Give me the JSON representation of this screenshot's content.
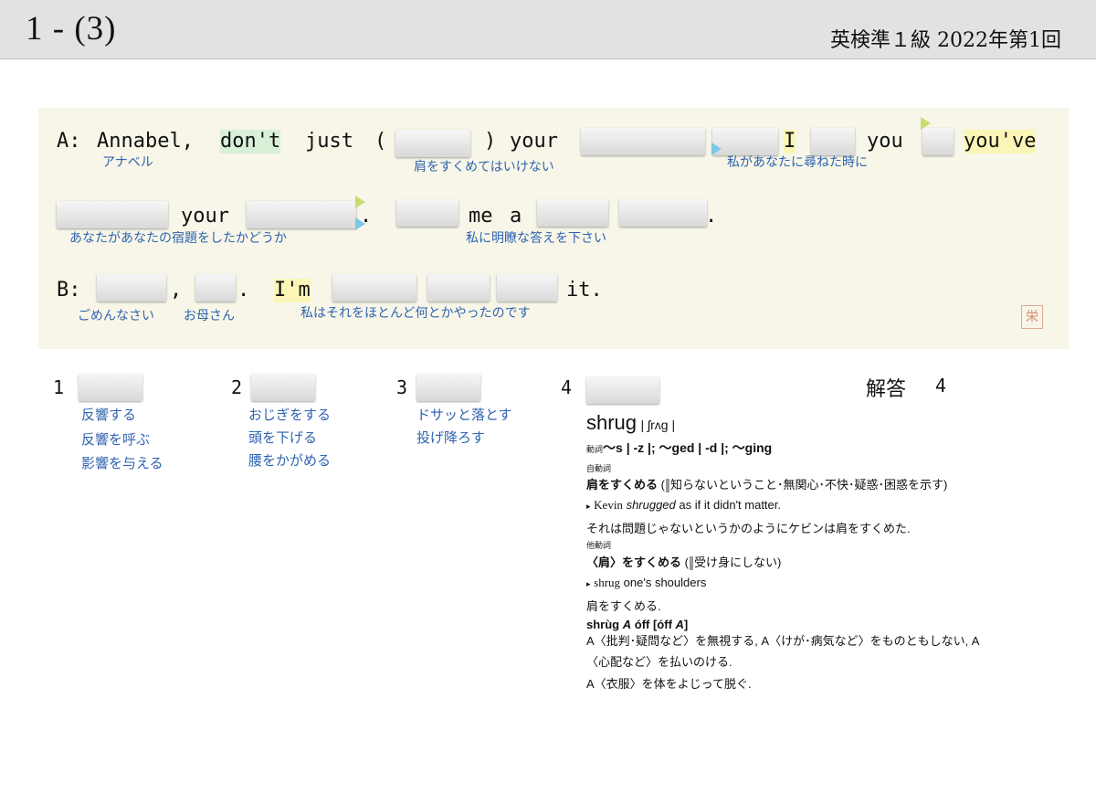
{
  "header": {
    "title": "1 - (3)",
    "subtitle": "英検準１級  2022年第1回"
  },
  "passage": {
    "line1": {
      "speaker": "A:",
      "w_annabel": "Annabel,",
      "w_dont": "don't",
      "w_just": "just",
      "w_paren_open": "(",
      "w_paren_close": ")",
      "w_your": "your",
      "w_I": "I",
      "w_you": "you",
      "w_youve": "you've",
      "g_annabel": "アナベル",
      "g_shrug": "肩をすくめてはいけない",
      "g_when": "私があなたに尋ねた時に"
    },
    "line2": {
      "w_your": "your",
      "w_dot1": ".",
      "w_me": "me",
      "w_a": "a",
      "w_dot2": ".",
      "g_homework": "あなたがあなたの宿題をしたかどうか",
      "g_answer": "私に明瞭な答えを下さい"
    },
    "line3": {
      "speaker": "B:",
      "w_comma": ",",
      "w_dot": ".",
      "w_im": "I'm",
      "w_it": "it.",
      "g_sorry": "ごめんなさい",
      "g_mom": "お母さん",
      "g_managed": "私はそれをほとんど何とかやったのです"
    }
  },
  "seal_char": "栄",
  "options": [
    {
      "num": "1",
      "glosses": [
        "反響する",
        "反響を呼ぶ",
        "影響を与える"
      ]
    },
    {
      "num": "2",
      "glosses": [
        "おじぎをする",
        "頭を下げる",
        "腰をかがめる"
      ]
    },
    {
      "num": "3",
      "glosses": [
        "ドサッと落とす",
        "投げ降ろす"
      ]
    },
    {
      "num": "4",
      "glosses": []
    }
  ],
  "answer": {
    "label": "解答",
    "value": "4"
  },
  "dictionary": {
    "headword": "shrug",
    "pron": "| ʃrʌg |",
    "pos_line_prefix": "動詞",
    "inflections": "〜s | -z |; 〜ged | -d |; 〜ging",
    "intransitive_tag": "自動詞",
    "sense1_head": "肩をすくめる",
    "sense1_open": "(",
    "sense1_note": "知らないということ･無関心･不快･疑惑･困惑を示す)",
    "ex1_marker": "▸",
    "ex1_en_a": "Kevin",
    "ex1_en_b": "shrugged",
    "ex1_en_c": "as if it didn't matter.",
    "ex1_ja": "それは問題じゃないというかのようにケビンは肩をすくめた.",
    "transitive_tag": "他動詞",
    "sense2_head": "〈肩〉をすくめる",
    "sense2_open": "(",
    "sense2_note": "受け身にしない)",
    "ex2_marker": "▸",
    "ex2_en_a": "shrug",
    "ex2_en_b": "one's shoulders",
    "ex2_ja": "肩をすくめる.",
    "phrase_a": "shrùg",
    "phrase_b": "A",
    "phrase_c": "óff [óff",
    "phrase_d": "A",
    "phrase_e": "]",
    "phrase_def1": "A〈批判･疑問など〉を無視する, A〈けが･病気など〉をものともしない, A",
    "phrase_def2": "〈心配など〉を払いのける.",
    "phrase_def3": "A〈衣服〉を体をよじって脱ぐ."
  }
}
